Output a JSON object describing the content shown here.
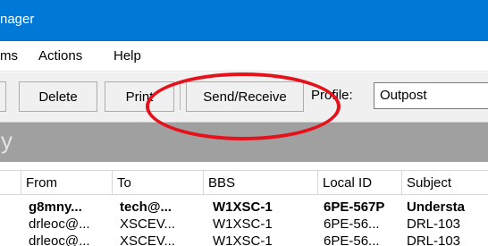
{
  "window": {
    "title": "nager"
  },
  "menu": {
    "items": [
      "ms",
      "Actions",
      "Help"
    ]
  },
  "toolbar": {
    "delete_label": "Delete",
    "print_label": "Print",
    "send_receive_label": "Send/Receive",
    "profile_label": "Profile:",
    "profile_value": "Outpost"
  },
  "folder": {
    "name": "y"
  },
  "table": {
    "columns": [
      "From",
      "To",
      "BBS",
      "Local ID",
      "Subject"
    ],
    "rows": [
      {
        "bold": true,
        "cells": [
          "g8mny...",
          "tech@...",
          "W1XSC-1",
          "6PE-567P",
          "Understa"
        ]
      },
      {
        "bold": false,
        "cells": [
          "drleoc@...",
          "XSCEV...",
          "W1XSC-1",
          "6PE-56...",
          "DRL-103"
        ]
      },
      {
        "bold": false,
        "cells": [
          "drleoc@...",
          "XSCEV...",
          "W1XSC-1",
          "6PE-56...",
          "DRL-103"
        ]
      }
    ]
  },
  "colors": {
    "titlebar": "#0078d7",
    "folderbar": "#a0a0a0",
    "annotation": "#e5121b"
  }
}
